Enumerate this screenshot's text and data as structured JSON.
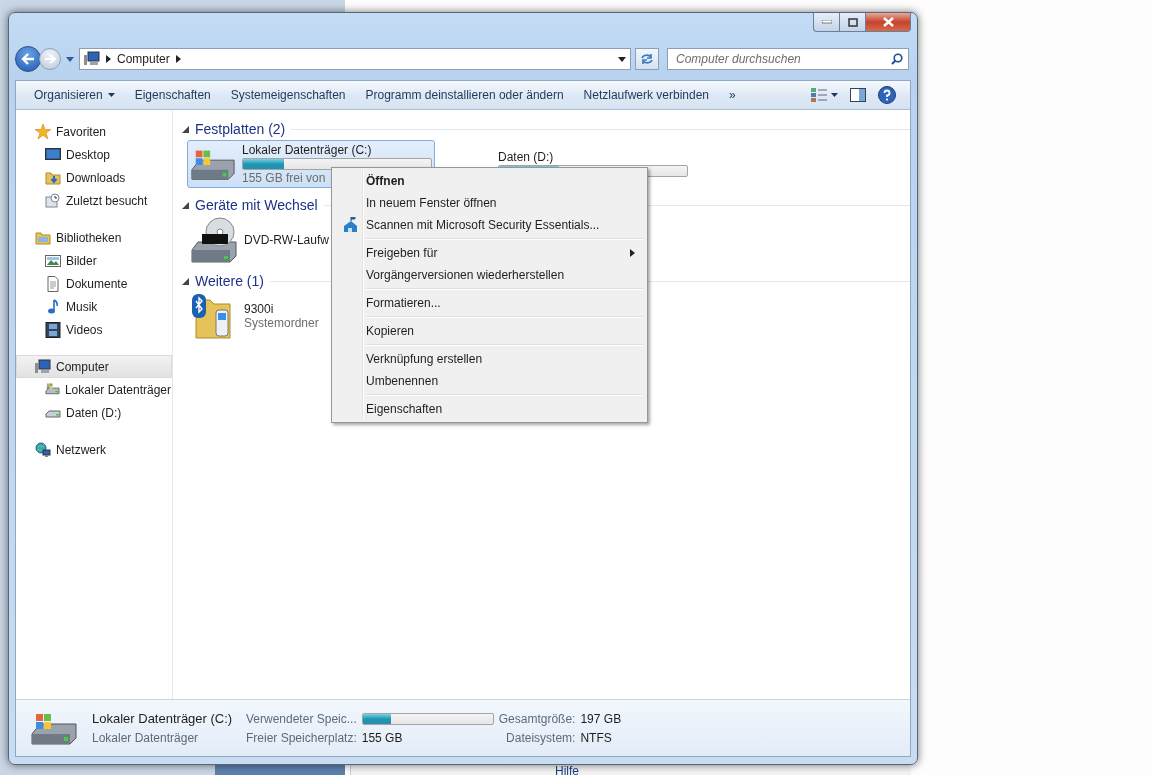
{
  "background": {
    "label": "Hilfe"
  },
  "address_bar": {
    "crumbs": [
      "Computer"
    ],
    "search_placeholder": "Computer durchsuchen"
  },
  "toolbar": {
    "items": [
      {
        "label": "Organisieren",
        "dropdown": true
      },
      {
        "label": "Eigenschaften",
        "dropdown": false
      },
      {
        "label": "Systemeigenschaften",
        "dropdown": false
      },
      {
        "label": "Programm deinstallieren oder ändern",
        "dropdown": false
      },
      {
        "label": "Netzlaufwerk verbinden",
        "dropdown": false
      }
    ],
    "overflow": "»"
  },
  "sidebar": {
    "groups": [
      {
        "label": "Favoriten",
        "kind": "favorites",
        "selected": false,
        "children": [
          {
            "label": "Desktop",
            "kind": "desktop",
            "selected": false
          },
          {
            "label": "Downloads",
            "kind": "downloads",
            "selected": false
          },
          {
            "label": "Zuletzt besucht",
            "kind": "recent",
            "selected": false
          }
        ]
      },
      {
        "label": "Bibliotheken",
        "kind": "libraries",
        "selected": false,
        "children": [
          {
            "label": "Bilder",
            "kind": "pictures",
            "selected": false
          },
          {
            "label": "Dokumente",
            "kind": "documents",
            "selected": false
          },
          {
            "label": "Musik",
            "kind": "music",
            "selected": false
          },
          {
            "label": "Videos",
            "kind": "videos",
            "selected": false
          }
        ]
      },
      {
        "label": "Computer",
        "kind": "computer",
        "selected": true,
        "children": [
          {
            "label": "Lokaler Datenträger",
            "kind": "system-drive",
            "selected": false
          },
          {
            "label": "Daten (D:)",
            "kind": "drive",
            "selected": false
          }
        ]
      },
      {
        "label": "Netzwerk",
        "kind": "network",
        "selected": false
      }
    ]
  },
  "sections": [
    {
      "title": "Festplatten (2)",
      "expanded": true,
      "items": [
        {
          "kind": "system-drive",
          "name": "Lokaler Datenträger (C:)",
          "level": 0.22,
          "detail": "155 GB frei von",
          "selected": true
        },
        {
          "kind": "drive",
          "name": "Daten (D:)",
          "level": 0.32,
          "selected": false
        }
      ]
    },
    {
      "title": "Geräte mit Wechsel",
      "expanded": true,
      "items": [
        {
          "kind": "dvd",
          "name": "DVD-RW-Laufw",
          "selected": false
        }
      ]
    },
    {
      "title": "Weitere (1)",
      "expanded": true,
      "items": [
        {
          "kind": "phone",
          "name": "9300i",
          "detail": "Systemordner",
          "selected": false
        }
      ]
    }
  ],
  "context_menu": {
    "groups": [
      [
        {
          "label": "Öffnen",
          "default": true,
          "submenu": false,
          "icon": false
        },
        {
          "label": "In neuem Fenster öffnen",
          "default": false,
          "submenu": false,
          "icon": false
        },
        {
          "label": "Scannen mit Microsoft Security Essentials...",
          "default": false,
          "submenu": false,
          "icon": true
        }
      ],
      [
        {
          "label": "Freigeben für",
          "default": false,
          "submenu": true,
          "icon": false
        },
        {
          "label": "Vorgängerversionen wiederherstellen",
          "default": false,
          "submenu": false,
          "icon": false
        }
      ],
      [
        {
          "label": "Formatieren...",
          "default": false,
          "submenu": false,
          "icon": false
        }
      ],
      [
        {
          "label": "Kopieren",
          "default": false,
          "submenu": false,
          "icon": false
        }
      ],
      [
        {
          "label": "Verknüpfung erstellen",
          "default": false,
          "submenu": false,
          "icon": false
        },
        {
          "label": "Umbenennen",
          "default": false,
          "submenu": false,
          "icon": false
        }
      ],
      [
        {
          "label": "Eigenschaften",
          "default": false,
          "submenu": false,
          "icon": false
        }
      ]
    ]
  },
  "details_pane": {
    "title": "Lokaler Datenträger (C:)",
    "subtitle": "Lokaler Datenträger",
    "fields": [
      {
        "label": "Verwendeter Speic...",
        "level": 0.22
      },
      {
        "label": "Gesamtgröße:",
        "value": "197 GB"
      },
      {
        "label": "Freier Speicherplatz:",
        "value": "155 GB"
      },
      {
        "label": "Dateisystem:",
        "value": "NTFS"
      }
    ]
  }
}
